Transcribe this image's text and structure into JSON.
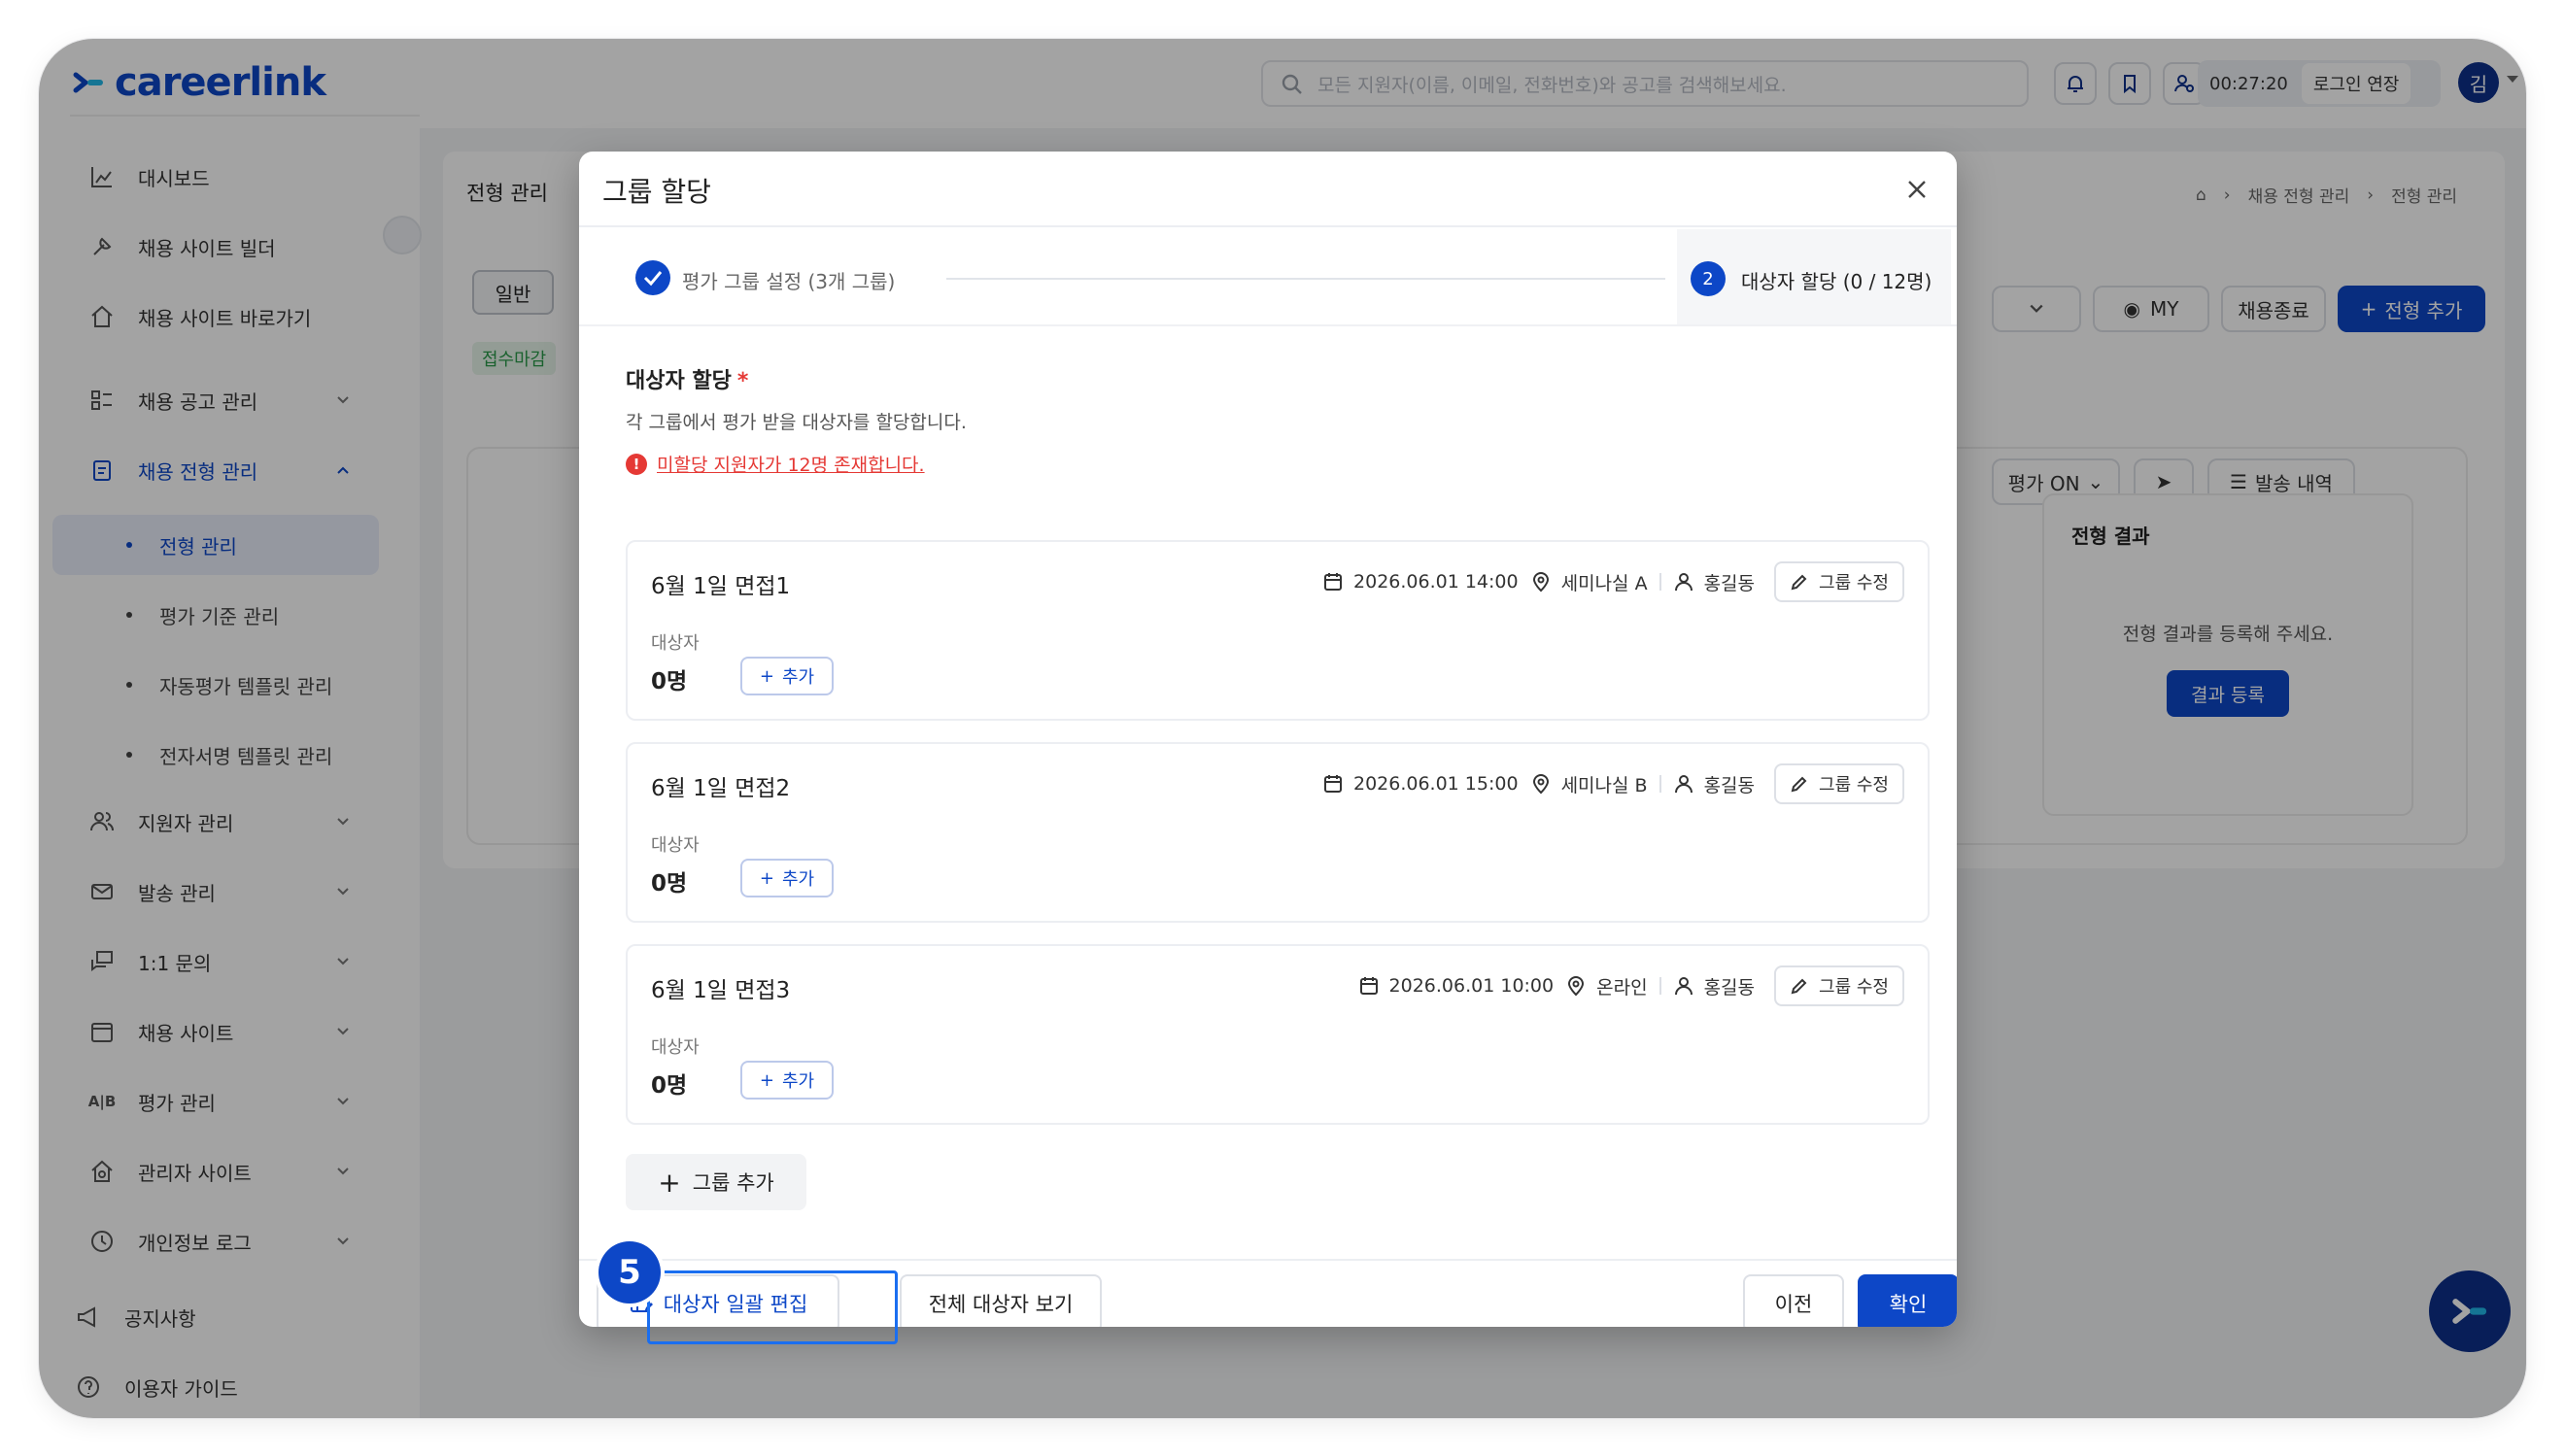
{
  "app": {
    "logo_text": "careerlink"
  },
  "header": {
    "search_placeholder": "모든 지원자(이름, 이메일, 전화번호)와 공고를 검색해보세요.",
    "timer": "00:27:20",
    "extend_label": "로그인 연장",
    "avatar_initial": "김"
  },
  "sidebar": {
    "items": [
      {
        "label": "대시보드",
        "icon": "chart-icon"
      },
      {
        "label": "채용 사이트 빌더",
        "icon": "tools-icon"
      },
      {
        "label": "채용 사이트 바로가기",
        "icon": "home-link-icon"
      },
      {
        "label": "채용 공고 관리",
        "icon": "list-icon"
      },
      {
        "label": "채용 전형 관리",
        "icon": "clipboard-icon"
      },
      {
        "label": "전형 관리"
      },
      {
        "label": "평가 기준 관리"
      },
      {
        "label": "자동평가 템플릿 관리"
      },
      {
        "label": "전자서명 템플릿 관리"
      },
      {
        "label": "지원자 관리",
        "icon": "users-icon"
      },
      {
        "label": "발송 관리",
        "icon": "mail-icon"
      },
      {
        "label": "1:1 문의",
        "icon": "chat-icon"
      },
      {
        "label": "채용 사이트",
        "icon": "calendar-icon"
      },
      {
        "label": "평가 관리",
        "icon": "ab-icon"
      },
      {
        "label": "관리자 사이트",
        "icon": "admin-home-icon"
      },
      {
        "label": "개인정보 로그",
        "icon": "history-icon"
      },
      {
        "label": "공지사항",
        "icon": "megaphone-icon"
      },
      {
        "label": "이용자 가이드",
        "icon": "help-icon"
      }
    ]
  },
  "background": {
    "page_title": "전형 관리",
    "breadcrumb": [
      "채용 전형 관리",
      "전형 관리"
    ],
    "tab_general": "일반",
    "badge": "접수마감",
    "my_label": "MY",
    "close_label": "채용종료",
    "add_label": "전형 추가",
    "eval_on": "평가 ON",
    "send_history": "발송 내역",
    "result_title": "전형 결과",
    "result_desc": "전형 결과를 등록해 주세요.",
    "result_button": "결과 등록"
  },
  "modal": {
    "title": "그룹 할당",
    "step1": "평가 그룹 설정 (3개 그룹)",
    "step2_number": "2",
    "step2": "대상자 할당 (0 / 12명)",
    "section_title": "대상자 할당",
    "required_mark": "*",
    "section_desc": "각 그룹에서 평가 받을 대상자를 할당합니다.",
    "warning": "미할당 지원자가 12명 존재합니다.",
    "groups": [
      {
        "name": "6월 1일 면접1",
        "datetime": "2026.06.01 14:00",
        "place": "세미나실 A",
        "person": "홍길동",
        "edit": "그룹 수정",
        "sub_label": "대상자",
        "count": "0명",
        "add": "추가"
      },
      {
        "name": "6월 1일 면접2",
        "datetime": "2026.06.01 15:00",
        "place": "세미나실 B",
        "person": "홍길동",
        "edit": "그룹 수정",
        "sub_label": "대상자",
        "count": "0명",
        "add": "추가"
      },
      {
        "name": "6월 1일 면접3",
        "datetime": "2026.06.01 10:00",
        "place": "온라인",
        "person": "홍길동",
        "edit": "그룹 수정",
        "sub_label": "대상자",
        "count": "0명",
        "add": "추가"
      }
    ],
    "add_group": "그룹 추가",
    "bulk_edit": "대상자 일괄 편집",
    "view_all": "전체 대상자 보기",
    "prev": "이전",
    "confirm": "확인"
  },
  "tutorial": {
    "step_number": "5"
  },
  "colors": {
    "primary": "#0d47c7",
    "danger": "#e53935",
    "highlight": "#1a6ef0"
  }
}
